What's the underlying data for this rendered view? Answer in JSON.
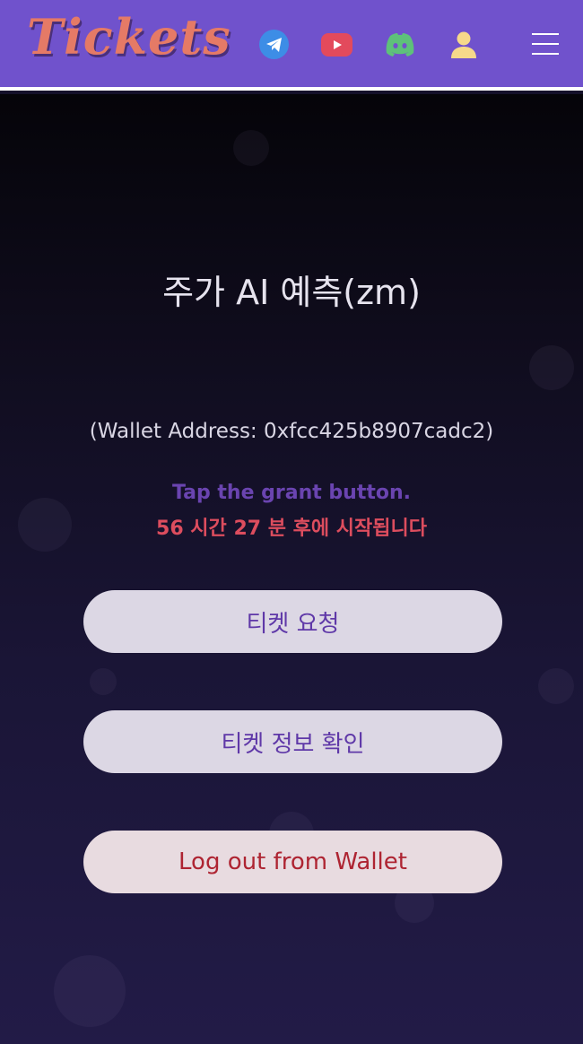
{
  "header": {
    "logo_text": "Tickets",
    "icons": [
      "telegram-icon",
      "youtube-icon",
      "discord-icon",
      "user-icon",
      "menu-icon"
    ],
    "colors": {
      "background": "#7052cc",
      "logo": "#e57a66"
    }
  },
  "main": {
    "title": "주가 AI 예측(zm)",
    "wallet_address": "(Wallet Address: 0xfcc425b8907cadc2)",
    "grant_hint": "Tap the grant button.",
    "countdown": "56 시간 27 분 후에 시작됩니다",
    "buttons": {
      "request": "티켓 요청",
      "info": "티켓 정보 확인",
      "logout": "Log out from Wallet"
    },
    "colors": {
      "grant_hint": "#6a44b0",
      "countdown": "#dd4d5e",
      "button_text": "#5f38a8",
      "logout_text": "#ae2432"
    }
  }
}
